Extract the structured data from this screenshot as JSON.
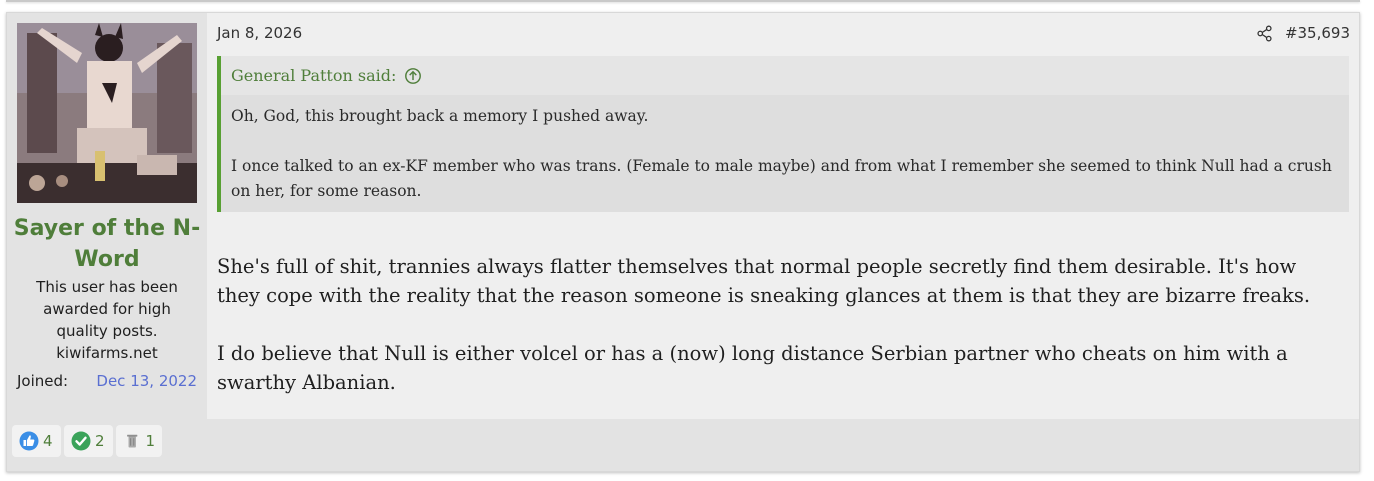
{
  "user": {
    "username": "Sayer of the N-Word",
    "title": "This user has been awarded for high quality posts.",
    "site": "kiwifarms.net",
    "joined_label": "Joined:",
    "joined_date": "Dec 13, 2022",
    "avatar_icon": "avatar-image"
  },
  "post": {
    "date": "Jan 8, 2026",
    "number": "#35,693",
    "share_icon": "share-icon"
  },
  "quote": {
    "author_line": "General Patton said:",
    "paragraphs": [
      "Oh, God, this brought back a memory I pushed away.",
      "I once talked to an ex-KF member who was trans. (Female to male maybe) and from what I remember she seemed to think Null had a crush on her, for some reason."
    ]
  },
  "message": {
    "paragraphs": [
      "She's full of shit, trannies always flatter themselves that normal people secretly find them desirable. It's how they cope with the reality that the reason someone is sneaking glances at them is that they are bizarre freaks.",
      "I do believe that Null is either volcel or has a (now) long distance Serbian partner who cheats on him with a swarthy Albanian."
    ]
  },
  "reactions": [
    {
      "icon": "thumbs-up-icon",
      "count": "4",
      "color": "#3a8ee6"
    },
    {
      "icon": "checkmark-icon",
      "count": "2",
      "color": "#3aa35a"
    },
    {
      "icon": "trash-can-icon",
      "count": "1",
      "color": "#a9a9a9"
    }
  ],
  "colors": {
    "username": "#4f7e3a",
    "quote_border": "#58a033",
    "link": "#5a6fd1"
  }
}
